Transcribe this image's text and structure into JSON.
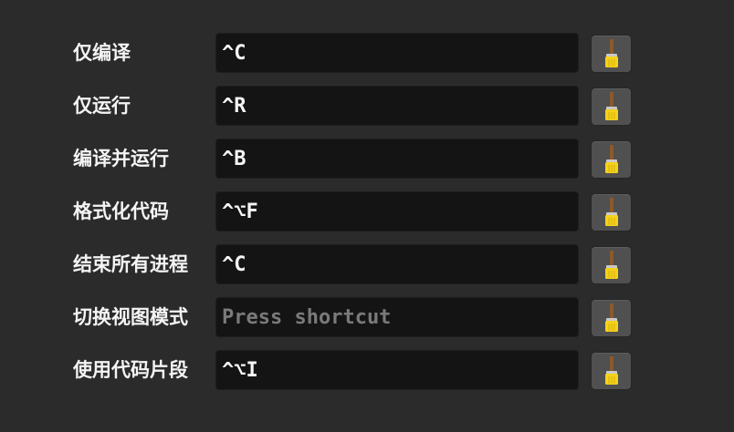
{
  "rows": [
    {
      "label": "仅编译",
      "value": "^C",
      "placeholder": false
    },
    {
      "label": "仅运行",
      "value": "^R",
      "placeholder": false
    },
    {
      "label": "编译并运行",
      "value": "^B",
      "placeholder": false
    },
    {
      "label": "格式化代码",
      "value": "^⌥F",
      "placeholder": false
    },
    {
      "label": "结束所有进程",
      "value": "^C",
      "placeholder": false
    },
    {
      "label": "切换视图模式",
      "value": "Press shortcut",
      "placeholder": true
    },
    {
      "label": "使用代码片段",
      "value": "^⌥I",
      "placeholder": false
    }
  ],
  "clear_icon": "brush-icon",
  "colors": {
    "background": "#2b2b2b",
    "field_background": "#141414",
    "button_background": "#505050",
    "brush_handle": "#8a5a2b",
    "brush_bristles": "#f5d21a",
    "placeholder_text": "#7a7a7a"
  }
}
